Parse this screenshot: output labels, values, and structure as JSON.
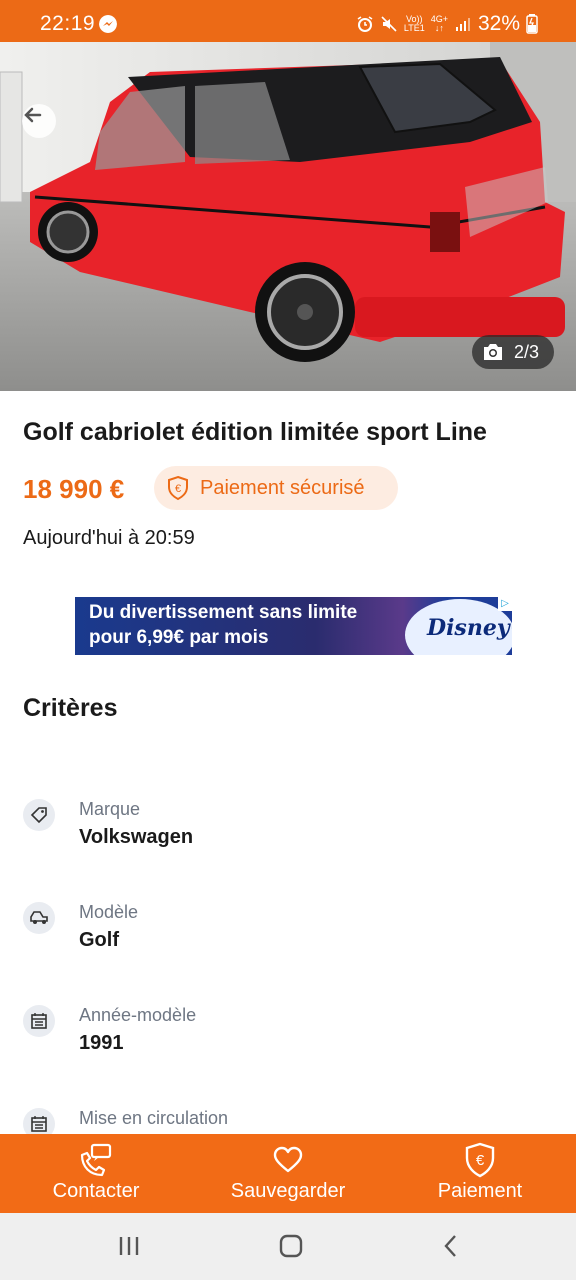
{
  "status_bar": {
    "time": "22:19",
    "net_top": "Vo))",
    "net_bottom": "LTE1",
    "gen_top": "4G+",
    "gen_bottom": "↓↑",
    "battery": "32%"
  },
  "photo": {
    "counter": "2/3"
  },
  "listing": {
    "title": "Golf cabriolet édition limitée sport Line",
    "price": "18 990 €",
    "secure_payment_badge": "Paiement sécurisé",
    "posted": "Aujourd'hui à 20:59"
  },
  "ad": {
    "line1": "Du divertissement sans limite",
    "line2": "pour 6,99€ par mois",
    "brand": "Disney+"
  },
  "criteria": {
    "heading": "Critères",
    "items": [
      {
        "label": "Marque",
        "value": "Volkswagen",
        "icon": "tag-icon"
      },
      {
        "label": "Modèle",
        "value": "Golf",
        "icon": "car-icon"
      },
      {
        "label": "Année-modèle",
        "value": "1991",
        "icon": "calendar-icon"
      },
      {
        "label": "Mise en circulation",
        "value": "",
        "icon": "calendar-icon"
      }
    ]
  },
  "actions": {
    "contact": "Contacter",
    "save": "Sauvegarder",
    "payment": "Paiement"
  },
  "colors": {
    "accent": "#ec6a16",
    "action_bar": "#f26b16",
    "badge_bg": "#fdece1"
  }
}
